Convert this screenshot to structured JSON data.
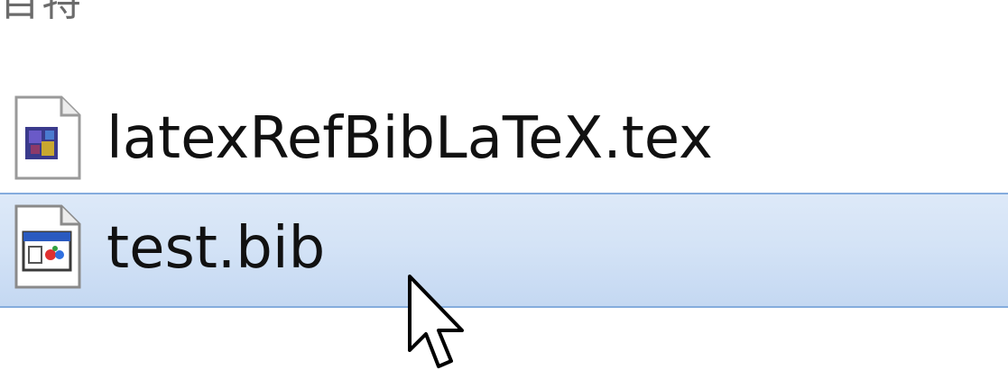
{
  "header": {
    "partial_text": "目特"
  },
  "files": [
    {
      "name": "latexRefBibLaTeX.tex",
      "icon": "tex-file-icon",
      "selected": false
    },
    {
      "name": "test.bib",
      "icon": "bib-file-icon",
      "selected": true
    }
  ],
  "colors": {
    "selection_border": "#84acdd",
    "selection_fill": "#d4e3f6"
  },
  "cursor": {
    "icon": "mouse-pointer-icon"
  }
}
